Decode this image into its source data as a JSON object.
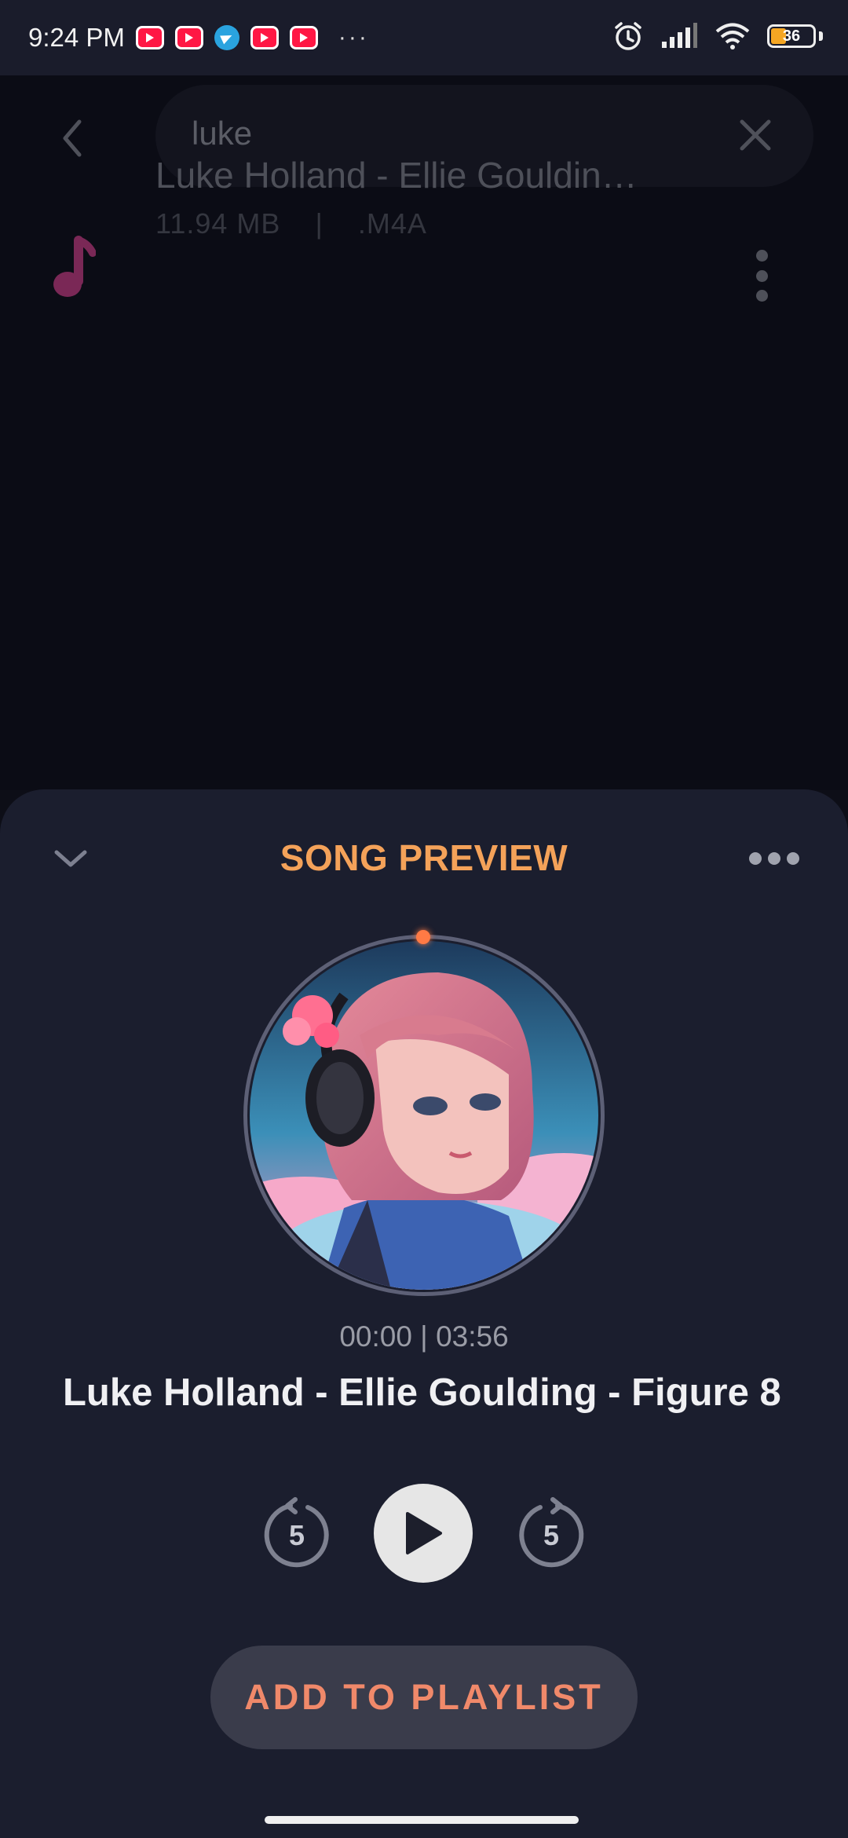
{
  "status_bar": {
    "time": "9:24 PM",
    "notification_icons": [
      "youtube-icon",
      "youtube-icon",
      "telegram-icon",
      "youtube-icon",
      "youtube-icon"
    ],
    "more": "···",
    "battery": "36"
  },
  "search": {
    "query": "luke"
  },
  "results": [
    {
      "title": "Luke Holland - Ellie Gouldin…",
      "size": "11.94 MB",
      "separator": "|",
      "format": ".M4A"
    }
  ],
  "preview": {
    "title": "SONG PREVIEW",
    "time": "00:00 | 03:56",
    "song_title": "Luke Holland - Ellie Goulding - Figure 8",
    "rewind_seconds": "5",
    "forward_seconds": "5",
    "add_button": "ADD TO PLAYLIST"
  },
  "colors": {
    "accent_orange": "#f4a259",
    "button_text": "#f0896a",
    "music_icon": "#7a2856"
  }
}
